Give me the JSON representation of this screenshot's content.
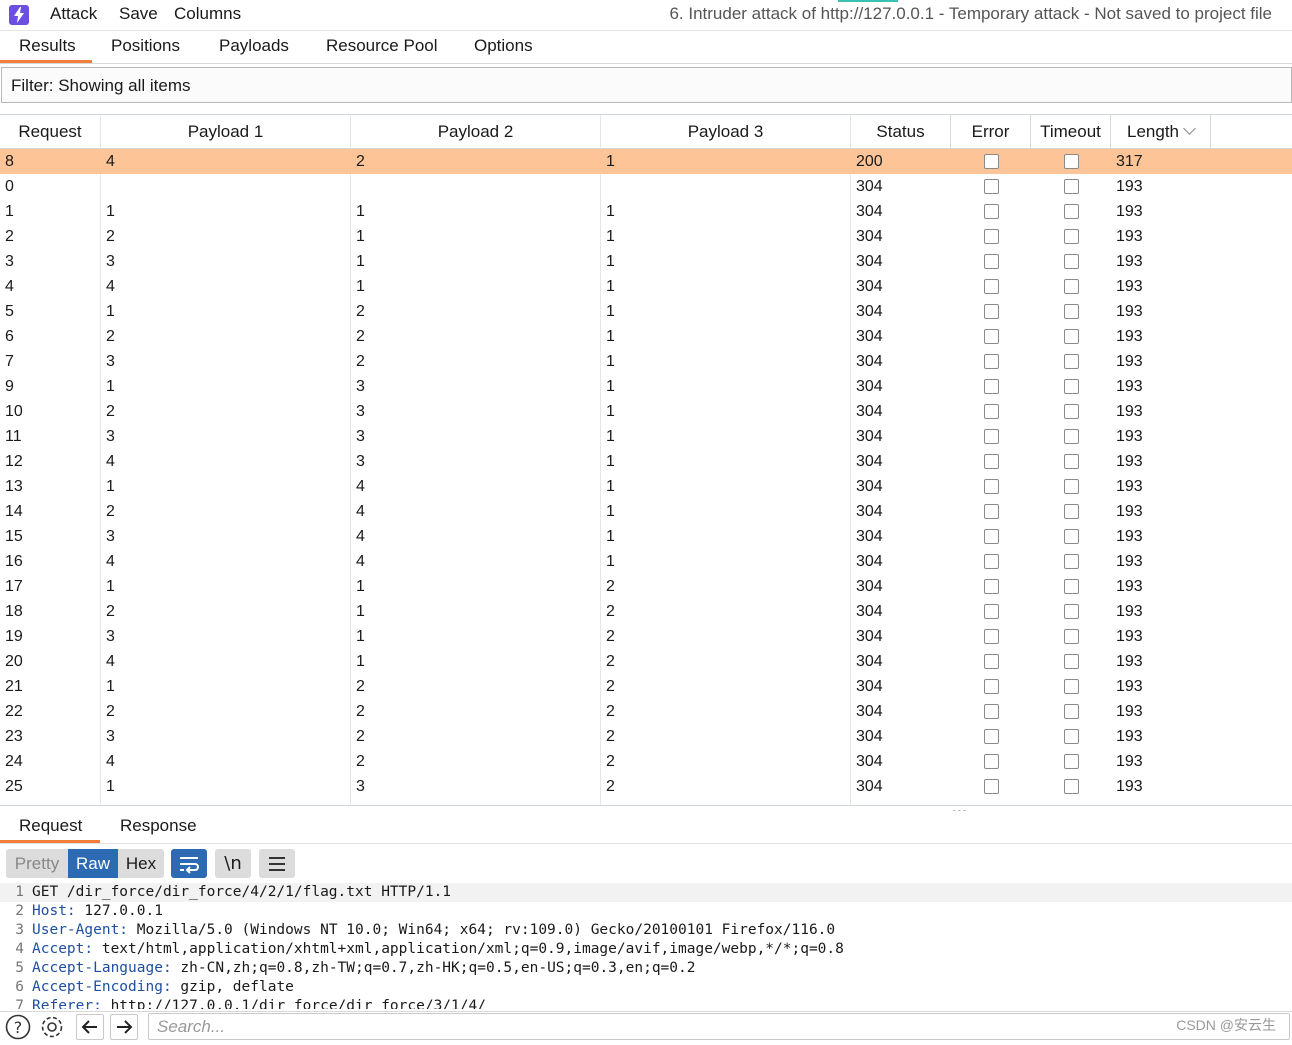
{
  "menubar": {
    "logo_icon": "lightning-bolt-icon",
    "items": [
      "Attack",
      "Save",
      "Columns"
    ],
    "window_title": "6. Intruder attack of http://127.0.0.1 - Temporary attack - Not saved to project file"
  },
  "tabs": [
    "Results",
    "Positions",
    "Payloads",
    "Resource Pool",
    "Options"
  ],
  "active_tab": "Results",
  "filter": {
    "text": "Filter: Showing all items"
  },
  "table": {
    "columns": [
      "Request",
      "Payload 1",
      "Payload 2",
      "Payload 3",
      "Status",
      "Error",
      "Timeout",
      "Length"
    ],
    "sorted_column": "Length",
    "selected_row_color": "#fdc597",
    "rows": [
      {
        "request": "8",
        "p1": "4",
        "p2": "2",
        "p3": "1",
        "status": "200",
        "length": "317",
        "selected": true
      },
      {
        "request": "0",
        "p1": "",
        "p2": "",
        "p3": "",
        "status": "304",
        "length": "193"
      },
      {
        "request": "1",
        "p1": "1",
        "p2": "1",
        "p3": "1",
        "status": "304",
        "length": "193"
      },
      {
        "request": "2",
        "p1": "2",
        "p2": "1",
        "p3": "1",
        "status": "304",
        "length": "193"
      },
      {
        "request": "3",
        "p1": "3",
        "p2": "1",
        "p3": "1",
        "status": "304",
        "length": "193"
      },
      {
        "request": "4",
        "p1": "4",
        "p2": "1",
        "p3": "1",
        "status": "304",
        "length": "193"
      },
      {
        "request": "5",
        "p1": "1",
        "p2": "2",
        "p3": "1",
        "status": "304",
        "length": "193"
      },
      {
        "request": "6",
        "p1": "2",
        "p2": "2",
        "p3": "1",
        "status": "304",
        "length": "193"
      },
      {
        "request": "7",
        "p1": "3",
        "p2": "2",
        "p3": "1",
        "status": "304",
        "length": "193"
      },
      {
        "request": "9",
        "p1": "1",
        "p2": "3",
        "p3": "1",
        "status": "304",
        "length": "193"
      },
      {
        "request": "10",
        "p1": "2",
        "p2": "3",
        "p3": "1",
        "status": "304",
        "length": "193"
      },
      {
        "request": "11",
        "p1": "3",
        "p2": "3",
        "p3": "1",
        "status": "304",
        "length": "193"
      },
      {
        "request": "12",
        "p1": "4",
        "p2": "3",
        "p3": "1",
        "status": "304",
        "length": "193"
      },
      {
        "request": "13",
        "p1": "1",
        "p2": "4",
        "p3": "1",
        "status": "304",
        "length": "193"
      },
      {
        "request": "14",
        "p1": "2",
        "p2": "4",
        "p3": "1",
        "status": "304",
        "length": "193"
      },
      {
        "request": "15",
        "p1": "3",
        "p2": "4",
        "p3": "1",
        "status": "304",
        "length": "193"
      },
      {
        "request": "16",
        "p1": "4",
        "p2": "4",
        "p3": "1",
        "status": "304",
        "length": "193"
      },
      {
        "request": "17",
        "p1": "1",
        "p2": "1",
        "p3": "2",
        "status": "304",
        "length": "193"
      },
      {
        "request": "18",
        "p1": "2",
        "p2": "1",
        "p3": "2",
        "status": "304",
        "length": "193"
      },
      {
        "request": "19",
        "p1": "3",
        "p2": "1",
        "p3": "2",
        "status": "304",
        "length": "193"
      },
      {
        "request": "20",
        "p1": "4",
        "p2": "1",
        "p3": "2",
        "status": "304",
        "length": "193"
      },
      {
        "request": "21",
        "p1": "1",
        "p2": "2",
        "p3": "2",
        "status": "304",
        "length": "193"
      },
      {
        "request": "22",
        "p1": "2",
        "p2": "2",
        "p3": "2",
        "status": "304",
        "length": "193"
      },
      {
        "request": "23",
        "p1": "3",
        "p2": "2",
        "p3": "2",
        "status": "304",
        "length": "193"
      },
      {
        "request": "24",
        "p1": "4",
        "p2": "2",
        "p3": "2",
        "status": "304",
        "length": "193"
      },
      {
        "request": "25",
        "p1": "1",
        "p2": "3",
        "p3": "2",
        "status": "304",
        "length": "193"
      }
    ]
  },
  "detail_tabs": [
    "Request",
    "Response"
  ],
  "active_detail_tab": "Request",
  "editor_toolbar": {
    "modes": [
      "Pretty",
      "Raw",
      "Hex"
    ],
    "active_mode": "Raw",
    "wrap_icon": "word-wrap-icon",
    "newline_label": "\\n",
    "menu_icon": "hamburger-menu-icon"
  },
  "editor": {
    "lines": [
      {
        "n": "1",
        "key": "",
        "text": "GET /dir_force/dir_force/4/2/1/flag.txt HTTP/1.1"
      },
      {
        "n": "2",
        "key": "Host:",
        "text": " 127.0.0.1"
      },
      {
        "n": "3",
        "key": "User-Agent:",
        "text": " Mozilla/5.0 (Windows NT 10.0; Win64; x64; rv:109.0) Gecko/20100101 Firefox/116.0"
      },
      {
        "n": "4",
        "key": "Accept:",
        "text": " text/html,application/xhtml+xml,application/xml;q=0.9,image/avif,image/webp,*/*;q=0.8"
      },
      {
        "n": "5",
        "key": "Accept-Language:",
        "text": " zh-CN,zh;q=0.8,zh-TW;q=0.7,zh-HK;q=0.5,en-US;q=0.3,en;q=0.2"
      },
      {
        "n": "6",
        "key": "Accept-Encoding:",
        "text": " gzip, deflate"
      },
      {
        "n": "7",
        "key": "Referer:",
        "text": " http://127.0.0.1/dir_force/dir_force/3/1/4/"
      }
    ]
  },
  "bottombar": {
    "icons": [
      "help-icon",
      "settings-icon",
      "back-arrow-icon",
      "forward-arrow-icon"
    ],
    "search_placeholder": "Search...",
    "watermark": "CSDN @安云生"
  }
}
